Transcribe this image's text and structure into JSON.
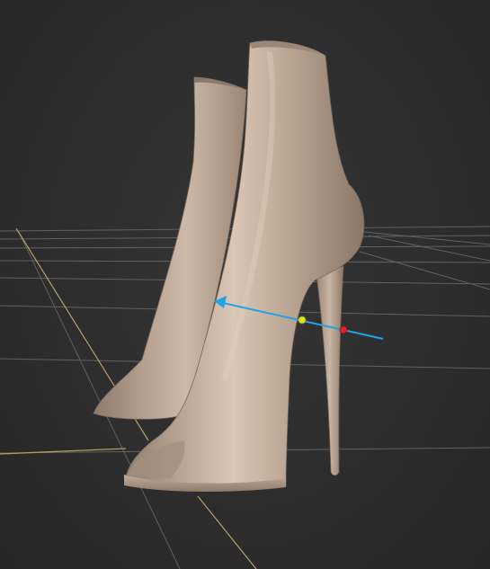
{
  "viewport": {
    "background_color": "#2b2b2b",
    "grid": {
      "visible": true,
      "line_color": "#6a6a6a",
      "axis_color": "#b5a060"
    },
    "model": {
      "name": "boots",
      "material_color": "#b9a493"
    },
    "gizmo": {
      "line_color": "#1fa3e6",
      "start_handle_color": "#d8e02a",
      "end_handle_color": "#e0242a",
      "arrow_icon": "arrowhead-left-icon"
    }
  }
}
